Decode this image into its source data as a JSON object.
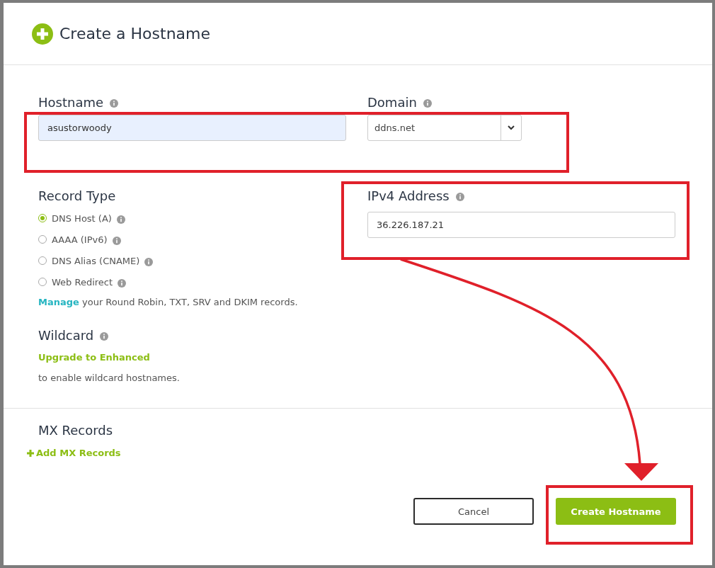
{
  "dialog": {
    "title": "Create a Hostname"
  },
  "hostname": {
    "label": "Hostname",
    "value": "asustorwoody"
  },
  "domain": {
    "label": "Domain",
    "value": "ddns.net"
  },
  "record_type": {
    "label": "Record Type",
    "options": [
      {
        "label": "DNS Host (A)",
        "selected": true
      },
      {
        "label": "AAAA (IPv6)",
        "selected": false
      },
      {
        "label": "DNS Alias (CNAME)",
        "selected": false
      },
      {
        "label": "Web Redirect",
        "selected": false
      }
    ]
  },
  "manage_note": {
    "link": "Manage",
    "text": "your Round Robin, TXT, SRV and DKIM records."
  },
  "ipv4": {
    "label": "IPv4 Address",
    "value": "36.226.187.21"
  },
  "wildcard": {
    "label": "Wildcard",
    "link": "Upgrade to Enhanced",
    "note": "to enable wildcard hostnames."
  },
  "mx_records": {
    "label": "MX Records",
    "add_link": "Add MX Records"
  },
  "buttons": {
    "cancel": "Cancel",
    "submit": "Create Hostname"
  }
}
